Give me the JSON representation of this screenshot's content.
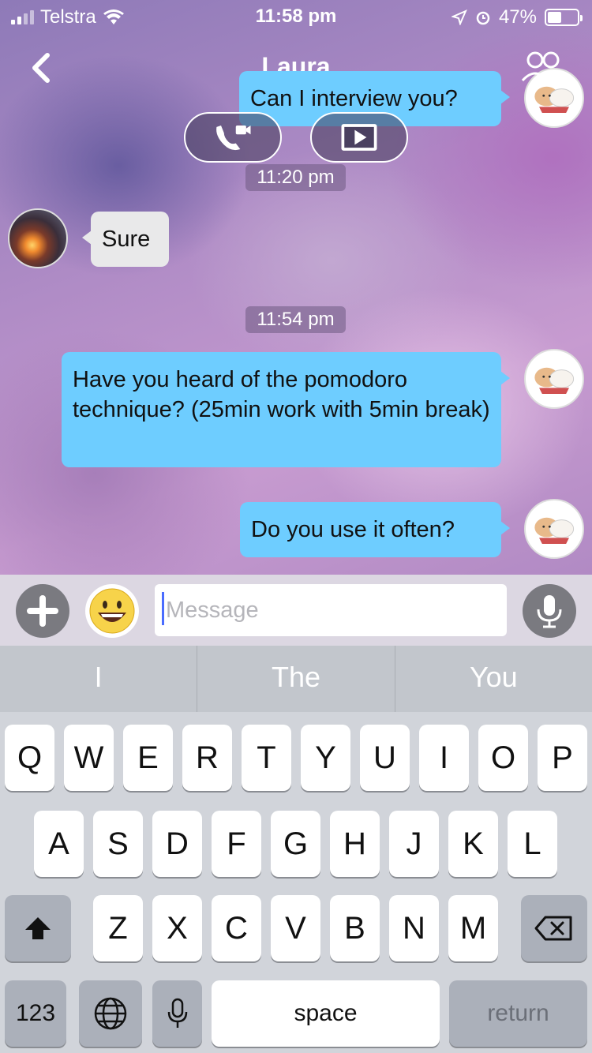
{
  "status_bar": {
    "carrier": "Telstra",
    "time": "11:58 pm",
    "battery": "47%"
  },
  "header": {
    "title": "Laura"
  },
  "messages": [
    {
      "from": "me",
      "text": "Can I interview you?"
    },
    {
      "from": "them",
      "text": "Sure"
    },
    {
      "from": "me",
      "text": "Have you heard of the pomodoro technique? (25min work with 5min break)"
    },
    {
      "from": "me",
      "text": "Do you use it often?"
    }
  ],
  "timestamps": [
    "11:20 pm",
    "11:54 pm"
  ],
  "input": {
    "placeholder": "Message"
  },
  "suggestions": [
    "I",
    "The",
    "You"
  ],
  "keyboard": {
    "row1": [
      "Q",
      "W",
      "E",
      "R",
      "T",
      "Y",
      "U",
      "I",
      "O",
      "P"
    ],
    "row2": [
      "A",
      "S",
      "D",
      "F",
      "G",
      "H",
      "J",
      "K",
      "L"
    ],
    "row3": [
      "Z",
      "X",
      "C",
      "V",
      "B",
      "N",
      "M"
    ],
    "numbers_label": "123",
    "space_label": "space",
    "return_label": "return"
  },
  "colors": {
    "my_bubble": "#6ecdff",
    "their_bubble": "#e9e9ea",
    "keyboard_bg": "#d1d4da"
  },
  "icons": [
    "back-chevron-icon",
    "group-icon",
    "phone-video-icon",
    "film-play-icon",
    "plus-icon",
    "emoji-icon",
    "microphone-icon",
    "shift-icon",
    "backspace-icon",
    "globe-icon",
    "dictation-icon"
  ]
}
